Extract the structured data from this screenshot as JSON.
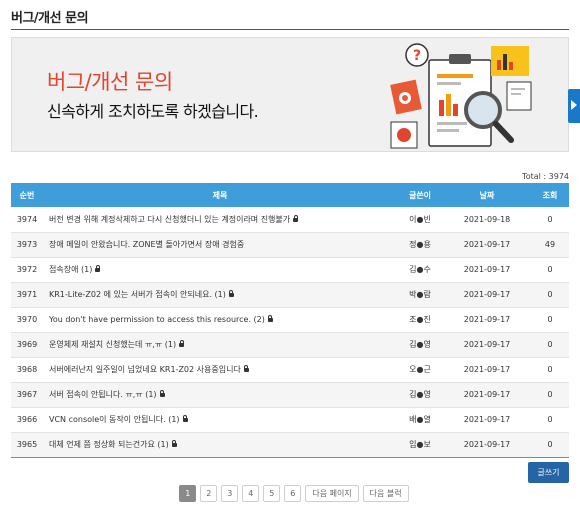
{
  "page": {
    "title": "버그/개선 문의"
  },
  "banner": {
    "heading": "버그/개선 문의",
    "subheading": "신속하게 조치하도록 하겠습니다.",
    "colors": {
      "heading": "#e0462e"
    }
  },
  "side_tab": {
    "icon": "chevron-right-icon"
  },
  "board": {
    "total_label": "Total : 3974",
    "columns": {
      "no": "순번",
      "title": "제목",
      "author": "글쓴이",
      "date": "날짜",
      "views": "조회"
    },
    "rows": [
      {
        "no": "3974",
        "title": "버전 변경 위해 계정삭제하고 다시 신청했더니 있는 계정이라며 진행불가",
        "locked": true,
        "author": "이●빈",
        "date": "2021-09-18",
        "views": "0"
      },
      {
        "no": "3973",
        "title": "장애 메일이 안왔습니다. ZONE별 돌아가면서 장애 경험중",
        "locked": false,
        "author": "정●용",
        "date": "2021-09-17",
        "views": "49"
      },
      {
        "no": "3972",
        "title": "접속장애 (1)",
        "locked": true,
        "author": "김●수",
        "date": "2021-09-17",
        "views": "0"
      },
      {
        "no": "3971",
        "title": "KR1-Lite-Z02 에 있는 서버가 접속이 안되네요. (1)",
        "locked": true,
        "author": "박●람",
        "date": "2021-09-17",
        "views": "0"
      },
      {
        "no": "3970",
        "title": "You don't have permission to access this resource. (2)",
        "locked": true,
        "author": "조●진",
        "date": "2021-09-17",
        "views": "0"
      },
      {
        "no": "3969",
        "title": "운영체제 재설치 신청했는데 ㅠ,ㅠ (1)",
        "locked": true,
        "author": "김●영",
        "date": "2021-09-17",
        "views": "0"
      },
      {
        "no": "3968",
        "title": "서버에러난지 일주일이 넘었네요 KR1-Z02 사용중입니다",
        "locked": true,
        "author": "오●근",
        "date": "2021-09-17",
        "views": "0"
      },
      {
        "no": "3967",
        "title": "서버 접속이 안됩니다. ㅠ,ㅠ (1)",
        "locked": true,
        "author": "김●영",
        "date": "2021-09-17",
        "views": "0"
      },
      {
        "no": "3966",
        "title": "VCN console이 동작이 안됩니다. (1)",
        "locked": true,
        "author": "배●열",
        "date": "2021-09-17",
        "views": "0"
      },
      {
        "no": "3965",
        "title": "대체 언제 쯤 정상화 되는건가요 (1)",
        "locked": true,
        "author": "임●보",
        "date": "2021-09-17",
        "views": "0"
      }
    ]
  },
  "write_button": {
    "label": "글쓰기"
  },
  "pagination": {
    "pages": [
      "1",
      "2",
      "3",
      "4",
      "5",
      "6"
    ],
    "current": "1",
    "next_page": "다음 페이지",
    "next_block": "다음 블럭"
  }
}
